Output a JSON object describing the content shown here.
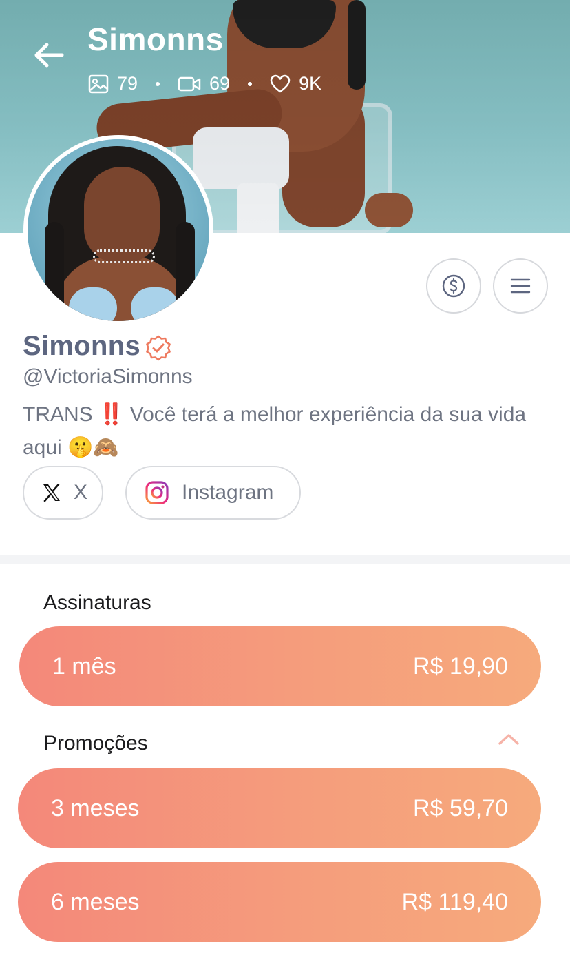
{
  "header": {
    "title": "Simonns",
    "stats": {
      "photos": "79",
      "videos": "69",
      "likes": "9K"
    }
  },
  "profile": {
    "name": "Simonns",
    "handle": "@VictoriaSimonns",
    "bio_prefix": "TRANS",
    "bio_bang": "‼️",
    "bio_text": "Você terá a melhor experiência da sua vida aqui",
    "bio_emojis": "🤫🙈",
    "verified_color": "#ee7a5f"
  },
  "socials": [
    {
      "label": "X",
      "icon": "x-logo-icon"
    },
    {
      "label": "Instagram",
      "icon": "instagram-icon"
    }
  ],
  "subscriptions": {
    "title": "Assinaturas",
    "plans": [
      {
        "label": "1 mês",
        "price": "R$ 19,90"
      }
    ]
  },
  "promotions": {
    "title": "Promoções",
    "plans": [
      {
        "label": "3 meses",
        "price": "R$ 59,70"
      },
      {
        "label": "6 meses",
        "price": "R$ 119,40"
      }
    ]
  },
  "colors": {
    "accent_start": "#f4887a",
    "accent_end": "#f6aa7c",
    "text_muted": "#6e7482"
  }
}
